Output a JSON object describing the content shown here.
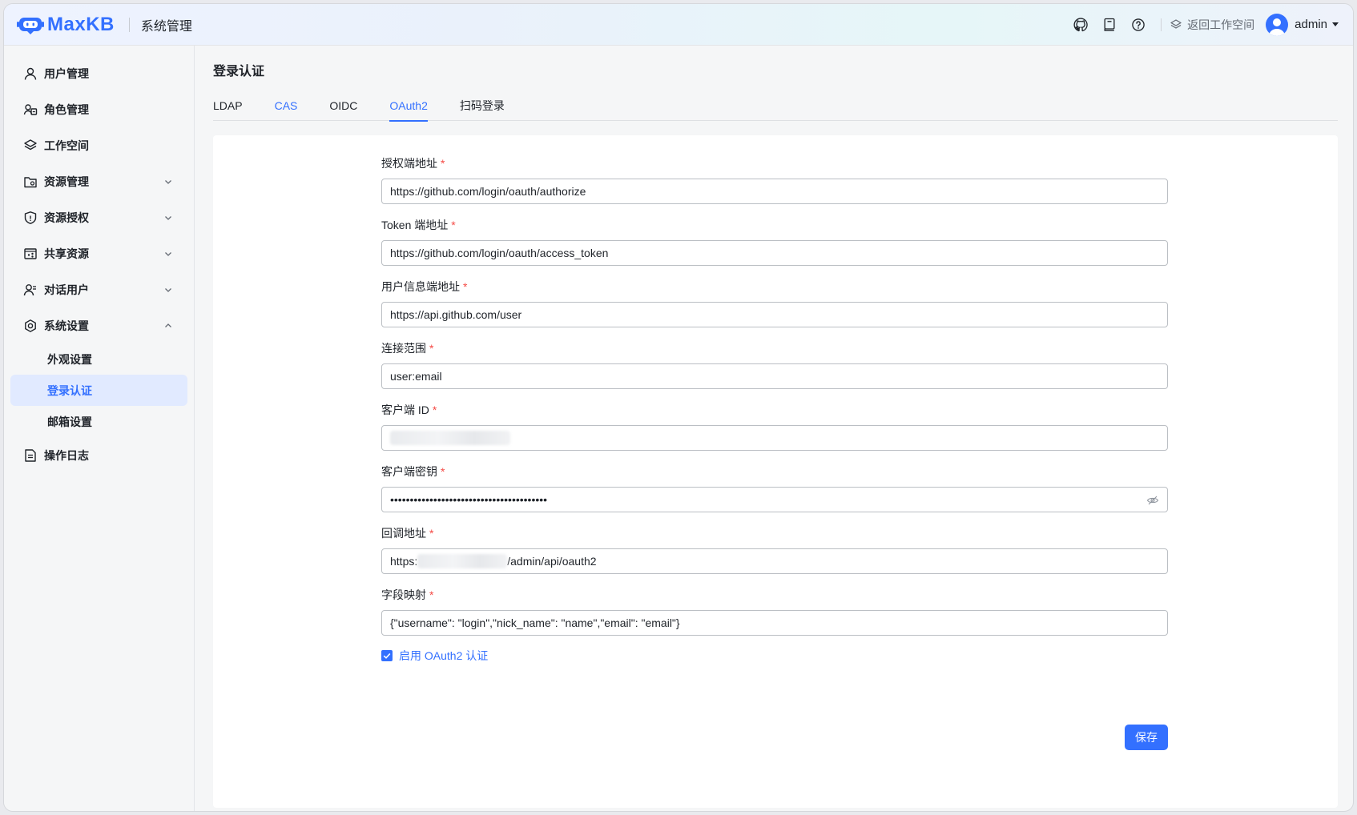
{
  "header": {
    "logo_text": "MaxKB",
    "title": "系统管理",
    "back_workspace": "返回工作空间",
    "user": "admin"
  },
  "sidebar": {
    "items": [
      {
        "label": "用户管理",
        "icon": "user-icon"
      },
      {
        "label": "角色管理",
        "icon": "role-icon"
      },
      {
        "label": "工作空间",
        "icon": "workspace-icon"
      },
      {
        "label": "资源管理",
        "icon": "resource-folder-icon",
        "expandable": true
      },
      {
        "label": "资源授权",
        "icon": "shield-icon",
        "expandable": true
      },
      {
        "label": "共享资源",
        "icon": "share-icon",
        "expandable": true
      },
      {
        "label": "对话用户",
        "icon": "chat-user-icon",
        "expandable": true
      },
      {
        "label": "系统设置",
        "icon": "gear-icon",
        "expanded": true
      }
    ],
    "sub_items": [
      "外观设置",
      "登录认证",
      "邮箱设置"
    ],
    "last_item": {
      "label": "操作日志",
      "icon": "log-icon"
    }
  },
  "main": {
    "title": "登录认证",
    "tabs": [
      "LDAP",
      "CAS",
      "OIDC",
      "OAuth2",
      "扫码登录"
    ],
    "active_tab": "OAuth2"
  },
  "form": {
    "fields": [
      {
        "label": "授权端地址",
        "value": "https://github.com/login/oauth/authorize"
      },
      {
        "label": "Token 端地址",
        "value": "https://github.com/login/oauth/access_token"
      },
      {
        "label": "用户信息端地址",
        "value": "https://api.github.com/user"
      },
      {
        "label": "连接范围",
        "value": "user:email"
      },
      {
        "label": "客户端 ID",
        "value": ""
      },
      {
        "label": "客户端密钥",
        "value": "••••••••••••••••••••••••••••••••••••••••"
      },
      {
        "label": "回调地址",
        "value_prefix": "https:",
        "value_suffix": "/admin/api/oauth2"
      },
      {
        "label": "字段映射",
        "value": "{\"username\": \"login\",\"nick_name\": \"name\",\"email\": \"email\"}"
      }
    ],
    "required_mark": "*",
    "enable_label": "启用 OAuth2 认证",
    "enable_checked": true,
    "save_label": "保存"
  },
  "colors": {
    "accent": "#3370ff",
    "required": "#f54a45"
  }
}
